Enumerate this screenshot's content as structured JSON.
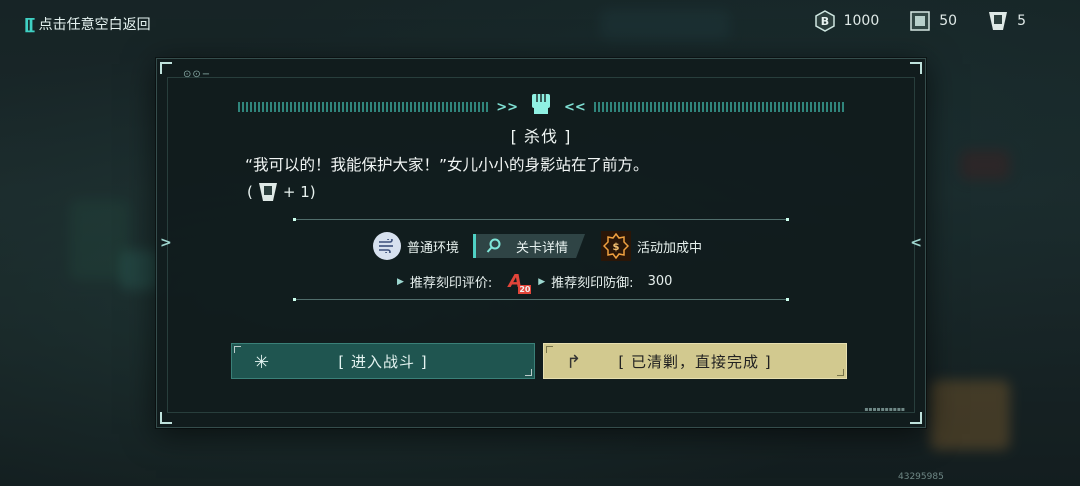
{
  "top_bar": {
    "back_label": "点击任意空白返回",
    "resources": [
      {
        "icon": "b-coin-icon",
        "value": "1000"
      },
      {
        "icon": "card-icon",
        "value": "50"
      },
      {
        "icon": "emblem-ticket-icon",
        "value": "5"
      }
    ]
  },
  "dialog": {
    "title": "[ 杀伐 ]",
    "quote": "“我可以的！我能保护大家！”女儿小小的身影站在了前方。",
    "reward": {
      "open": "(",
      "icon": "emblem-ticket-icon",
      "amount": "+ 1)"
    },
    "environment_label": "普通环境",
    "stage_detail_label": "关卡详情",
    "activity_label": "活动加成中",
    "recommend_rating_label": "推荐刻印评价:",
    "recommend_rating_grade": "A",
    "recommend_rating_level": "20",
    "recommend_defense_label": "推荐刻印防御:",
    "recommend_defense_value": "300",
    "battle_button": "[ 进入战斗 ]",
    "quick_button": "[ 已清剿，直接完成 ]"
  },
  "footer_id": "43295985",
  "colors": {
    "accent": "#4fd1c5",
    "battle": "#1f5550",
    "quick": "#d2c98f"
  }
}
